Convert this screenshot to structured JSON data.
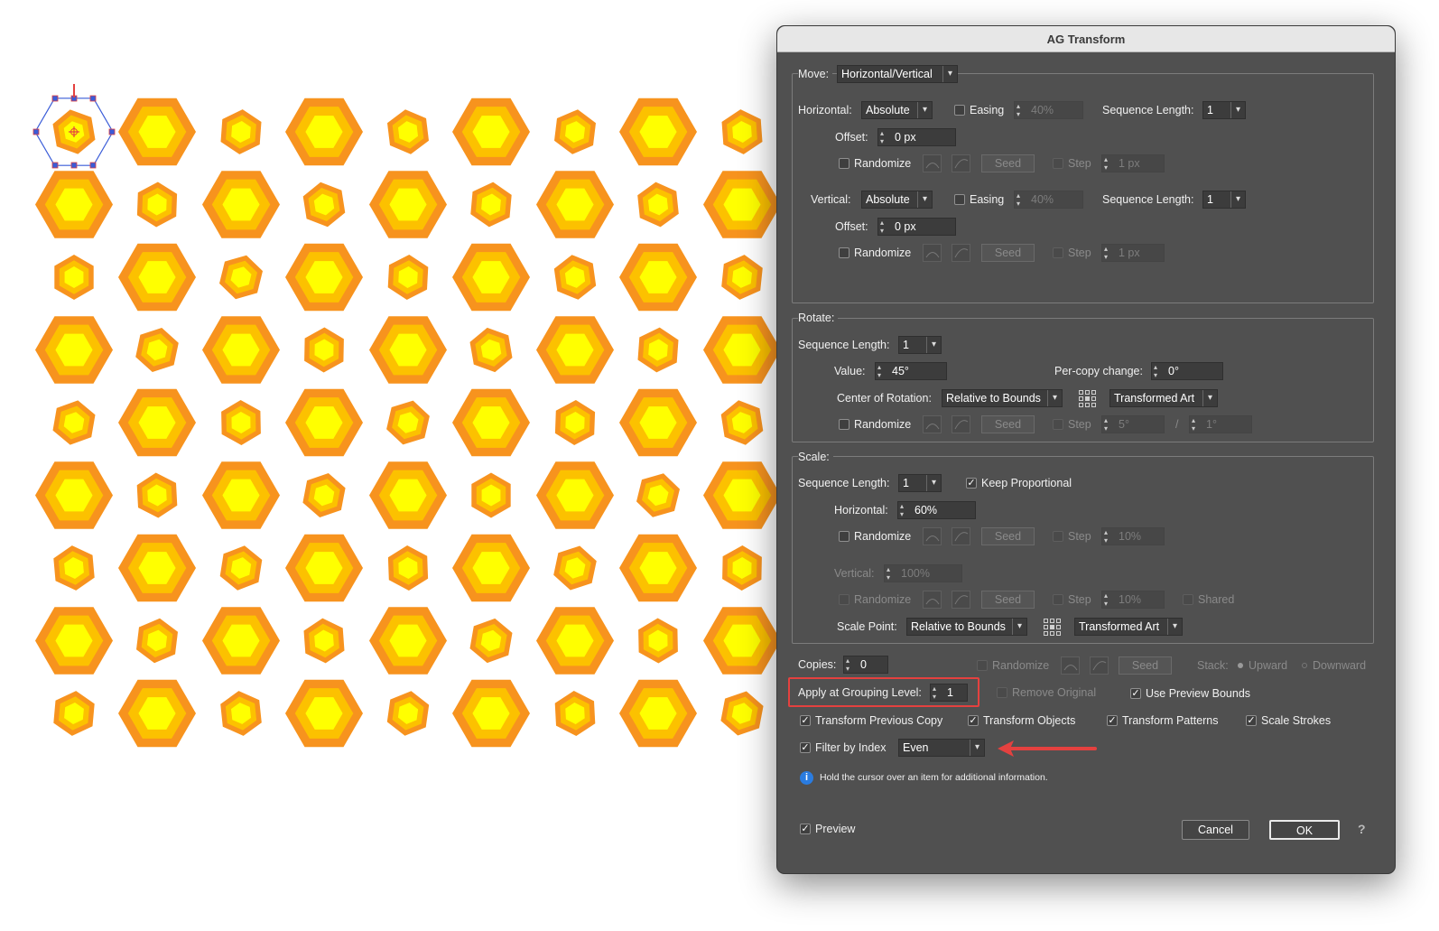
{
  "colors": {
    "hex_outer": "#f7931e",
    "hex_mid": "#fcc100",
    "hex_inner": "#ffff00",
    "selection": "#3a5cd8",
    "highlight": "#e4413f"
  },
  "dialog": {
    "title": "AG Transform",
    "move": {
      "label": "Move:",
      "mode": "Horizontal/Vertical",
      "horizontal": {
        "label": "Horizontal:",
        "type": "Absolute",
        "easing_label": "Easing",
        "easing_value": "40%",
        "seq_label": "Sequence Length:",
        "seq_value": "1",
        "offset_label": "Offset:",
        "offset_value": "0 px",
        "randomize_label": "Randomize",
        "seed_label": "Seed",
        "step_label": "Step",
        "step_value": "1 px"
      },
      "vertical": {
        "label": "Vertical:",
        "type": "Absolute",
        "easing_label": "Easing",
        "easing_value": "40%",
        "seq_label": "Sequence Length:",
        "seq_value": "1",
        "offset_label": "Offset:",
        "offset_value": "0 px",
        "randomize_label": "Randomize",
        "seed_label": "Seed",
        "step_label": "Step",
        "step_value": "1 px"
      }
    },
    "rotate": {
      "label": "Rotate:",
      "seq_label": "Sequence Length:",
      "seq_value": "1",
      "value_label": "Value:",
      "value": "45°",
      "per_copy_label": "Per-copy change:",
      "per_copy_value": "0°",
      "center_label": "Center of Rotation:",
      "center_value": "Relative to Bounds",
      "art_value": "Transformed Art",
      "randomize_label": "Randomize",
      "seed_label": "Seed",
      "step_label": "Step",
      "step_value": "5°",
      "slash": "/",
      "step_value2": "1°"
    },
    "scale": {
      "label": "Scale:",
      "seq_label": "Sequence Length:",
      "seq_value": "1",
      "keep_prop_label": "Keep Proportional",
      "horizontal_label": "Horizontal:",
      "horizontal_value": "60%",
      "randomize_label": "Randomize",
      "seed_label": "Seed",
      "step_label": "Step",
      "step_value": "10%",
      "vertical_label": "Vertical:",
      "vertical_value": "100%",
      "shared_label": "Shared",
      "point_label": "Scale Point:",
      "point_value": "Relative to Bounds",
      "art_value": "Transformed Art"
    },
    "copies": {
      "label": "Copies:",
      "value": "0",
      "randomize_label": "Randomize",
      "seed_label": "Seed",
      "stack_label": "Stack:",
      "upward_label": "Upward",
      "downward_label": "Downward"
    },
    "grouping": {
      "label": "Apply at Grouping Level:",
      "value": "1",
      "remove_original_label": "Remove Original",
      "use_preview_bounds_label": "Use Preview Bounds"
    },
    "options": {
      "transform_prev_copy": "Transform Previous Copy",
      "transform_objects": "Transform Objects",
      "transform_patterns": "Transform Patterns",
      "scale_strokes": "Scale Strokes"
    },
    "filter": {
      "label": "Filter by Index",
      "value": "Even"
    },
    "info_text": "Hold the cursor over an item for additional information.",
    "footer": {
      "preview_label": "Preview",
      "cancel_label": "Cancel",
      "ok_label": "OK",
      "help_label": "?"
    },
    "check_glyph": "✓"
  }
}
